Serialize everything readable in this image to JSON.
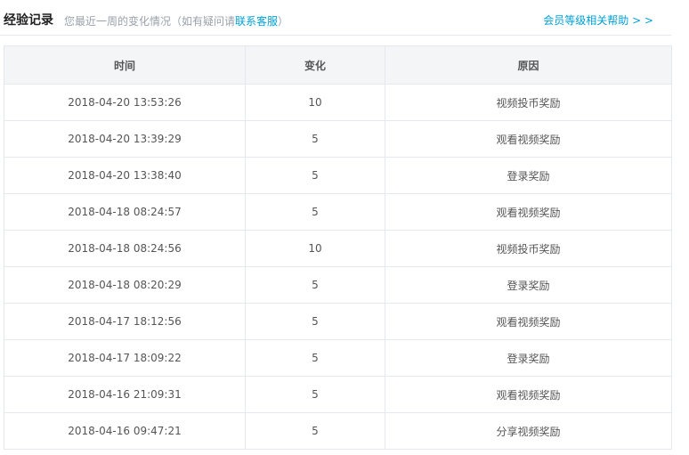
{
  "header": {
    "title": "经验记录",
    "subtitle_prefix": "您最近一周的变化情况（如有疑问请",
    "subtitle_link": "联系客服",
    "subtitle_suffix": "）",
    "help_link": "会员等级相关帮助 > >"
  },
  "table": {
    "columns": [
      "时间",
      "变化",
      "原因"
    ],
    "rows": [
      {
        "time": "2018-04-20 13:53:26",
        "change": "10",
        "reason": "视频投币奖励"
      },
      {
        "time": "2018-04-20 13:39:29",
        "change": "5",
        "reason": "观看视频奖励"
      },
      {
        "time": "2018-04-20 13:38:40",
        "change": "5",
        "reason": "登录奖励"
      },
      {
        "time": "2018-04-18 08:24:57",
        "change": "5",
        "reason": "观看视频奖励"
      },
      {
        "time": "2018-04-18 08:24:56",
        "change": "10",
        "reason": "视频投币奖励"
      },
      {
        "time": "2018-04-18 08:20:29",
        "change": "5",
        "reason": "登录奖励"
      },
      {
        "time": "2018-04-17 18:12:56",
        "change": "5",
        "reason": "观看视频奖励"
      },
      {
        "time": "2018-04-17 18:09:22",
        "change": "5",
        "reason": "登录奖励"
      },
      {
        "time": "2018-04-16 21:09:31",
        "change": "5",
        "reason": "观看视频奖励"
      },
      {
        "time": "2018-04-16 09:47:21",
        "change": "5",
        "reason": "分享视频奖励"
      }
    ]
  }
}
